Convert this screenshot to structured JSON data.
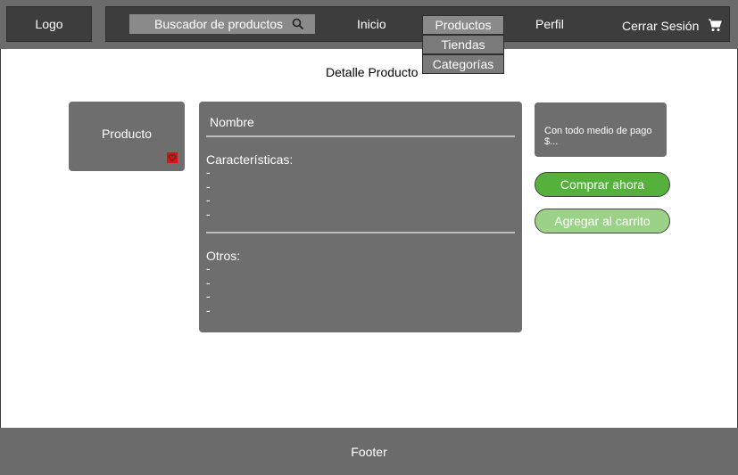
{
  "header": {
    "logo": "Logo",
    "search_label": "Buscador de productos",
    "nav": {
      "inicio": "Inicio",
      "perfil": "Perfil",
      "logout": "Cerrar Sesión"
    },
    "dropdown": [
      "Productos",
      "Tiendas",
      "Categorías"
    ]
  },
  "page": {
    "title": "Detalle Producto"
  },
  "product": {
    "image_label": "Producto",
    "name": "Nombre",
    "features_title": "Características:",
    "features": [
      "-",
      "-",
      "-",
      "-"
    ],
    "others_title": "Otros:",
    "others": [
      "-",
      "-",
      "-",
      "-"
    ]
  },
  "price": {
    "line1": "Con todo medio de pago",
    "line2": "$..."
  },
  "actions": {
    "buy": "Comprar ahora",
    "add_to_cart": "Agregar al carrito"
  },
  "footer": {
    "label": "Footer"
  },
  "colors": {
    "buy_button": "#55b13b",
    "cart_button": "#9bd287",
    "heart": "#dd1111"
  }
}
